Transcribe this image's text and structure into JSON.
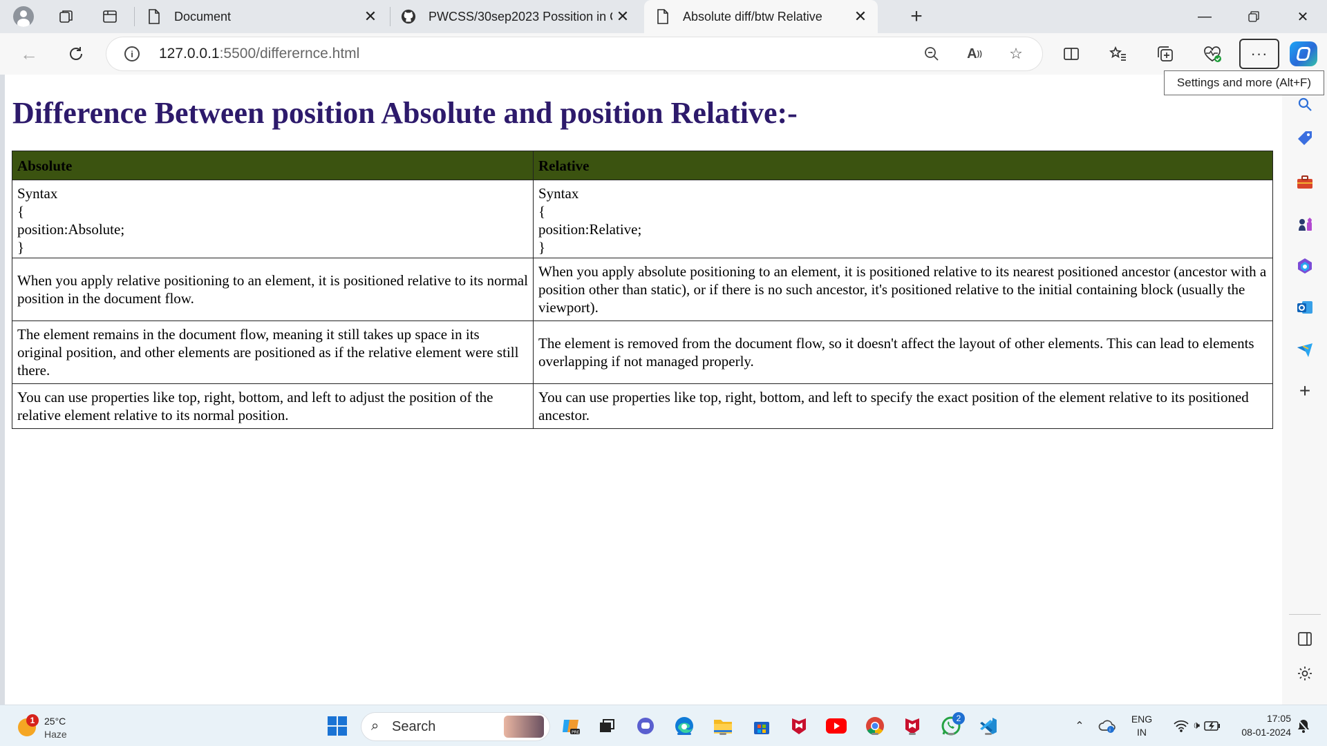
{
  "browser": {
    "tabs": [
      {
        "title": "Document",
        "icon": "page-icon",
        "active": false
      },
      {
        "title": "PWCSS/30sep2023 Possition in C",
        "icon": "github-icon",
        "active": false
      },
      {
        "title": "Absolute diff/btw Relative",
        "icon": "page-icon",
        "active": true
      }
    ],
    "url_host": "127.0.0.1",
    "url_path": ":5500/differernce.html",
    "more_tooltip": "Settings and more (Alt+F)"
  },
  "page": {
    "heading": "Difference Between position Absolute and position Relative:-",
    "heading_color": "#2d1a6b",
    "header_bg": "#3b5310",
    "table": {
      "headers": [
        "Absolute",
        "Relative"
      ],
      "syntax_row": [
        [
          "Syntax",
          "{",
          "position:Absolute;",
          "}"
        ],
        [
          "Syntax",
          "{",
          "position:Relative;",
          "}"
        ]
      ],
      "rows": [
        [
          "When you apply relative positioning to an element, it is positioned relative to its normal position in the document flow.",
          "When you apply absolute positioning to an element, it is positioned relative to its nearest positioned ancestor (ancestor with a position other than static), or if there is no such ancestor, it's positioned relative to the initial containing block (usually the viewport)."
        ],
        [
          "The element remains in the document flow, meaning it still takes up space in its original position, and other elements are positioned as if the relative element were still there.",
          "The element is removed from the document flow, so it doesn't affect the layout of other elements. This can lead to elements overlapping if not managed properly."
        ],
        [
          "You can use properties like top, right, bottom, and left to adjust the position of the relative element relative to its normal position.",
          "You can use properties like top, right, bottom, and left to specify the exact position of the element relative to its positioned ancestor."
        ]
      ]
    }
  },
  "taskbar": {
    "weather_temp": "25°C",
    "weather_condition": "Haze",
    "weather_badge": "1",
    "search_label": "Search",
    "whatsapp_badge": "2",
    "language": "ENG",
    "region": "IN",
    "time": "17:05",
    "date": "08-01-2024"
  }
}
